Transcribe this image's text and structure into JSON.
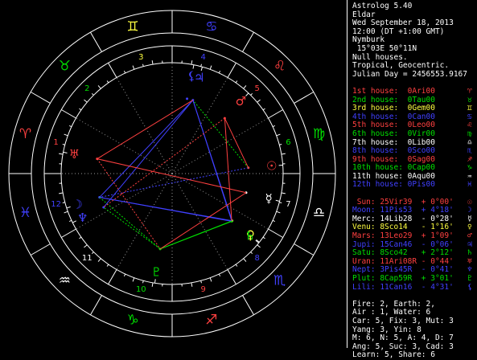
{
  "header": {
    "app": "Astrolog 5.40",
    "name": "Eldar",
    "date": "Wed September 18, 2013",
    "time": "12:00 (DT +1:00 GMT)",
    "place": "Nymburk",
    "coords": " 15°03E 50°11N",
    "house_system": "Null houses.",
    "zodiac": "Tropical, Geocentric.",
    "julian": "Julian Day = 2456553.9167"
  },
  "houses": [
    {
      "label": "1st house:",
      "value": "0Ari00",
      "color": "#ff4040",
      "glyph": "♈",
      "glyph_name": "aries-icon"
    },
    {
      "label": "2nd house:",
      "value": "0Tau00",
      "color": "#00e000",
      "glyph": "♉",
      "glyph_name": "taurus-icon"
    },
    {
      "label": "3rd house:",
      "value": "0Gem00",
      "color": "#ffff40",
      "glyph": "♊",
      "glyph_name": "gemini-icon"
    },
    {
      "label": "4th house:",
      "value": "0Can00",
      "color": "#4040ff",
      "glyph": "♋",
      "glyph_name": "cancer-icon"
    },
    {
      "label": "5th house:",
      "value": "0Leo00",
      "color": "#ff4040",
      "glyph": "♌",
      "glyph_name": "leo-icon"
    },
    {
      "label": "6th house:",
      "value": "0Vir00",
      "color": "#00e000",
      "glyph": "♍",
      "glyph_name": "virgo-icon"
    },
    {
      "label": "7th house:",
      "value": "0Lib00",
      "color": "#ffffff",
      "glyph": "♎",
      "glyph_name": "libra-icon"
    },
    {
      "label": "8th house:",
      "value": "0Sco00",
      "color": "#4040ff",
      "glyph": "♏",
      "glyph_name": "scorpio-icon"
    },
    {
      "label": "9th house:",
      "value": "0Sag00",
      "color": "#ff4040",
      "glyph": "♐",
      "glyph_name": "sagittarius-icon"
    },
    {
      "label": "10th house:",
      "value": "0Cap00",
      "color": "#00e000",
      "glyph": "♑",
      "glyph_name": "capricorn-icon"
    },
    {
      "label": "11th house:",
      "value": "0Aqu00",
      "color": "#ffffff",
      "glyph": "♒",
      "glyph_name": "aquarius-icon"
    },
    {
      "label": "12th house:",
      "value": "0Pis00",
      "color": "#4040ff",
      "glyph": "♓",
      "glyph_name": "pisces-icon"
    }
  ],
  "planets": [
    {
      "label": "Sun:",
      "value": "25Vir39",
      "extra": "+ 0°00'",
      "color": "#ff4040",
      "glyph": "☉",
      "glyph_name": "sun-icon"
    },
    {
      "label": "Moon:",
      "value": "11Pis53",
      "extra": "+ 4°18'",
      "color": "#4040ff",
      "glyph": "☽",
      "glyph_name": "moon-icon"
    },
    {
      "label": "Merc:",
      "value": "14Lib28",
      "extra": "- 0°28'",
      "color": "#ffffff",
      "glyph": "☿",
      "glyph_name": "mercury-icon"
    },
    {
      "label": "Venu:",
      "value": "8Sco14",
      "extra": "- 1°16'",
      "color": "#ffff40",
      "glyph": "♀",
      "glyph_name": "venus-icon"
    },
    {
      "label": "Mars:",
      "value": "13Leo29",
      "extra": "+ 1°09'",
      "color": "#ff4040",
      "glyph": "♂",
      "glyph_name": "mars-icon"
    },
    {
      "label": "Jupi:",
      "value": "15Can46",
      "extra": "- 0°06'",
      "color": "#4040ff",
      "glyph": "♃",
      "glyph_name": "jupiter-icon"
    },
    {
      "label": "Satu:",
      "value": "8Sco42",
      "extra": "+ 2°12'",
      "color": "#00e000",
      "glyph": "♄",
      "glyph_name": "saturn-icon"
    },
    {
      "label": "Uran:",
      "value": "11Ari08R",
      "extra": "- 0°44'",
      "color": "#ff4040",
      "glyph": "♅",
      "glyph_name": "uranus-icon"
    },
    {
      "label": "Nept:",
      "value": "3Pis45R",
      "extra": "- 0°41'",
      "color": "#4040ff",
      "glyph": "♆",
      "glyph_name": "neptune-icon"
    },
    {
      "label": "Plut:",
      "value": "8Cap59R",
      "extra": "+ 3°01'",
      "color": "#00e000",
      "glyph": "♇",
      "glyph_name": "pluto-icon"
    },
    {
      "label": "Lili:",
      "value": "11Can16",
      "extra": "- 4°31'",
      "color": "#4040ff",
      "glyph": "⚸",
      "glyph_name": "lilith-icon"
    }
  ],
  "summary": [
    "Fire: 2, Earth: 2,",
    "Air : 1, Water: 6",
    "Car: 5, Fix: 3, Mut: 3",
    "Yang: 3, Yin: 8",
    "M: 6, N: 5, A: 4, D: 7",
    "Ang: 5, Suc: 3, Cad: 3",
    "Learn: 5, Share: 6"
  ],
  "wheel": {
    "signs": [
      {
        "glyph": "♈",
        "name": "aries-icon",
        "color": "#ff4040"
      },
      {
        "glyph": "♉",
        "name": "taurus-icon",
        "color": "#00e000"
      },
      {
        "glyph": "♊",
        "name": "gemini-icon",
        "color": "#ffff40"
      },
      {
        "glyph": "♋",
        "name": "cancer-icon",
        "color": "#4040ff"
      },
      {
        "glyph": "♌",
        "name": "leo-icon",
        "color": "#ff4040"
      },
      {
        "glyph": "♍",
        "name": "virgo-icon",
        "color": "#00e000"
      },
      {
        "glyph": "♎",
        "name": "libra-icon",
        "color": "#ffffff"
      },
      {
        "glyph": "♏",
        "name": "scorpio-icon",
        "color": "#4040ff"
      },
      {
        "glyph": "♐",
        "name": "sagittarius-icon",
        "color": "#ff4040"
      },
      {
        "glyph": "♑",
        "name": "capricorn-icon",
        "color": "#00e000"
      },
      {
        "glyph": "♒",
        "name": "aquarius-icon",
        "color": "#ffffff"
      },
      {
        "glyph": "♓",
        "name": "pisces-icon",
        "color": "#4040ff"
      }
    ],
    "house_numbers": [
      "1",
      "2",
      "3",
      "4",
      "5",
      "6",
      "7",
      "8",
      "9",
      "10",
      "11",
      "12"
    ],
    "house_colors": [
      "#ff4040",
      "#00e000",
      "#ffff40",
      "#4040ff",
      "#ff4040",
      "#00e000",
      "#ffffff",
      "#4040ff",
      "#ff4040",
      "#00e000",
      "#ffffff",
      "#4040ff"
    ],
    "planet_longitudes": [
      175.65,
      341.88,
      194.47,
      218.23,
      133.48,
      105.77,
      218.7,
      11.13,
      333.75,
      278.98,
      101.27
    ],
    "aspects": [
      {
        "a": "Sun",
        "b": "Moon",
        "color": "#4040ff",
        "dash": true
      },
      {
        "a": "Sun",
        "b": "Jupi",
        "color": "#00e000",
        "dash": true
      },
      {
        "a": "Moon",
        "b": "Jupi",
        "color": "#4040ff",
        "dash": false
      },
      {
        "a": "Moon",
        "b": "Satu",
        "color": "#4040ff",
        "dash": false
      },
      {
        "a": "Moon",
        "b": "Venu",
        "color": "#4040ff",
        "dash": false
      },
      {
        "a": "Moon",
        "b": "Plut",
        "color": "#00e000",
        "dash": true
      },
      {
        "a": "Jupi",
        "b": "Satu",
        "color": "#4040ff",
        "dash": false
      },
      {
        "a": "Jupi",
        "b": "Venu",
        "color": "#4040ff",
        "dash": false
      },
      {
        "a": "Venu",
        "b": "Plut",
        "color": "#00e000",
        "dash": false
      },
      {
        "a": "Satu",
        "b": "Plut",
        "color": "#00e000",
        "dash": false
      },
      {
        "a": "Plut",
        "b": "Nept",
        "color": "#00e000",
        "dash": true
      },
      {
        "a": "Nept",
        "b": "Jupi",
        "color": "#4040ff",
        "dash": false
      },
      {
        "a": "Uran",
        "b": "Merc",
        "color": "#ff4040",
        "dash": false
      },
      {
        "a": "Uran",
        "b": "Jupi",
        "color": "#ff4040",
        "dash": false
      },
      {
        "a": "Uran",
        "b": "Plut",
        "color": "#ff4040",
        "dash": true
      },
      {
        "a": "Merc",
        "b": "Plut",
        "color": "#ff4040",
        "dash": false
      },
      {
        "a": "Mars",
        "b": "Sun",
        "color": "#ff4040",
        "dash": false
      },
      {
        "a": "Mars",
        "b": "Satu",
        "color": "#ff4040",
        "dash": false
      },
      {
        "a": "Mars",
        "b": "Nept",
        "color": "#ff4040",
        "dash": true
      }
    ]
  }
}
